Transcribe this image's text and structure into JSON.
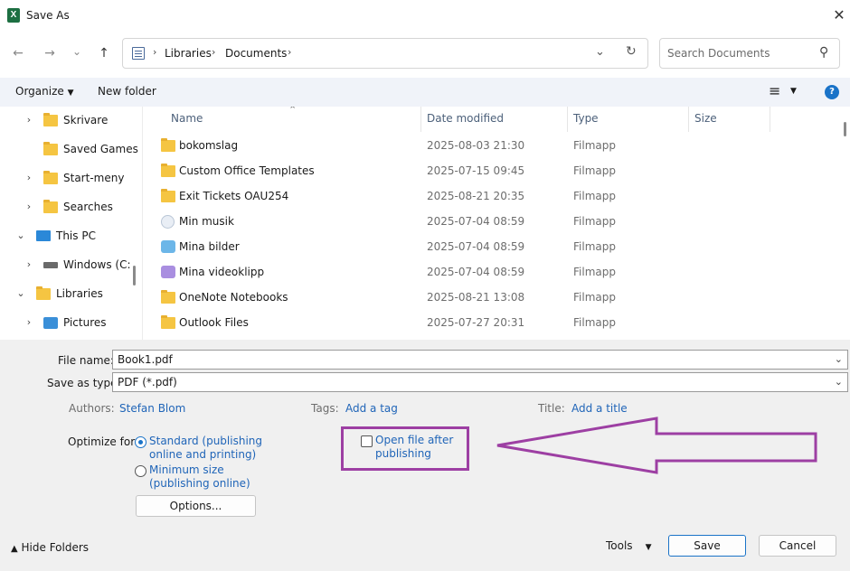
{
  "window": {
    "title": "Save As",
    "app_icon": "excel-icon",
    "close_glyph": "✕"
  },
  "nav": {
    "back": "←",
    "forward": "→",
    "recent": "⌄",
    "up": "↑",
    "breadcrumb": [
      "Libraries",
      "Documents"
    ],
    "search_placeholder": "Search Documents",
    "refresh": "↻",
    "dropdown": "⌄",
    "search_glyph": "⚲"
  },
  "toolbar": {
    "organize": "Organize",
    "new_folder": "New folder",
    "view_glyph": "≡",
    "help": "?"
  },
  "sidebar": {
    "items": [
      {
        "label": "Skrivare",
        "expander": "›",
        "icon": "printer-folder-icon"
      },
      {
        "label": "Saved Games",
        "expander": "",
        "icon": "folder-icon"
      },
      {
        "label": "Start-meny",
        "expander": "›",
        "icon": "start-menu-folder-icon"
      },
      {
        "label": "Searches",
        "expander": "›",
        "icon": "folder-icon"
      },
      {
        "label": "This PC",
        "expander": "⌄",
        "icon": "monitor-icon"
      },
      {
        "label": "Windows (C:",
        "expander": "›",
        "icon": "drive-icon"
      },
      {
        "label": "Libraries",
        "expander": "⌄",
        "icon": "folder-icon"
      },
      {
        "label": "Pictures",
        "expander": "›",
        "icon": "pictures-icon"
      }
    ]
  },
  "files": {
    "columns": [
      "Name",
      "Date modified",
      "Type",
      "Size"
    ],
    "sort_glyph": "⌃",
    "rows": [
      {
        "name": "bokomslag",
        "date": "2025-08-03 21:30",
        "type": "Filmapp",
        "icon": "folder"
      },
      {
        "name": "Custom Office Templates",
        "date": "2025-07-15 09:45",
        "type": "Filmapp",
        "icon": "folder"
      },
      {
        "name": "Exit Tickets OAU254",
        "date": "2025-08-21 20:35",
        "type": "Filmapp",
        "icon": "folder"
      },
      {
        "name": "Min musik",
        "date": "2025-07-04 08:59",
        "type": "Filmapp",
        "icon": "music"
      },
      {
        "name": "Mina bilder",
        "date": "2025-07-04 08:59",
        "type": "Filmapp",
        "icon": "pictures"
      },
      {
        "name": "Mina videoklipp",
        "date": "2025-07-04 08:59",
        "type": "Filmapp",
        "icon": "video"
      },
      {
        "name": "OneNote Notebooks",
        "date": "2025-08-21 13:08",
        "type": "Filmapp",
        "icon": "folder"
      },
      {
        "name": "Outlook Files",
        "date": "2025-07-27 20:31",
        "type": "Filmapp",
        "icon": "folder"
      }
    ]
  },
  "form": {
    "file_name_label": "File name:",
    "file_name": "Book1.pdf",
    "save_type_label": "Save as type:",
    "save_type": "PDF (*.pdf)",
    "authors_label": "Authors:",
    "authors": "Stefan Blom",
    "tags_label": "Tags:",
    "tags": "Add a tag",
    "title_label": "Title:",
    "title": "Add a title",
    "optimize_label": "Optimize for:",
    "opt_standard_1": "Standard (publishing",
    "opt_standard_2": "online and printing)",
    "opt_min_1": "Minimum size",
    "opt_min_2": "(publishing online)",
    "options_button": "Options...",
    "open_after_1": "Open file after",
    "open_after_2": "publishing"
  },
  "footer": {
    "hide_folders": "Hide Folders",
    "tools": "Tools",
    "save": "Save",
    "cancel": "Cancel"
  },
  "colors": {
    "accent": "#1a73c8",
    "highlight": "#9d3fa3",
    "folder": "#f5c542"
  }
}
